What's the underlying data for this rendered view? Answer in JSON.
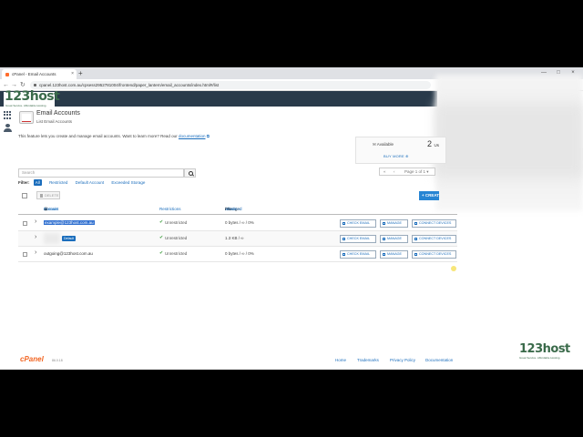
{
  "browser": {
    "tab_title": "cPanel - Email Accounts",
    "close_glyph": "×",
    "new_tab": "+",
    "url": "cpanel.123host.com.au/cpsess2952781004/frontend/paper_lantern/email_accounts/index.html#/list",
    "nav": {
      "back": "←",
      "forward": "→",
      "reload": "↻"
    },
    "window": {
      "minimize": "—",
      "maximize": "□",
      "close": "×"
    }
  },
  "brand": {
    "logo": "123host",
    "tagline": "Great Service. Affordable Hosting."
  },
  "page": {
    "title": "Email Accounts",
    "subtitle": "List Email Accounts",
    "intro": "This feature lets you create and manage email accounts. Want to learn more? Read our",
    "intro_link": "documentation",
    "link_icon": "⧉"
  },
  "stats": {
    "label": "Available",
    "count": "2",
    "unit": "Us",
    "buy_more": "BUY MORE ⊕"
  },
  "search": {
    "placeholder": "Search"
  },
  "filter": {
    "label": "Filter:",
    "items": [
      "All",
      "Restricted",
      "Default Account",
      "Exceeded Storage"
    ]
  },
  "pager": {
    "first": "«",
    "prev": "‹",
    "text": "Page 1 of 1 ▾"
  },
  "toolbar": {
    "delete": "DELETE",
    "create": "+ CREATE"
  },
  "table": {
    "headers": {
      "account": "Account",
      "at": "@",
      "domain": "Domain",
      "restrictions": "Restrictions",
      "storage_prefix": "Storage:",
      "storage_used": "Used",
      "storage_sep": "/",
      "storage_alloc": "Allocated",
      "storage_pct": "/ %"
    },
    "rows": [
      {
        "account": "example@123host.com.au",
        "restriction": "Unrestricted",
        "storage": "0 bytes / ∞ / 0%",
        "highlighted": true
      },
      {
        "account": "",
        "default_badge": "Default",
        "restriction": "Unrestricted",
        "storage": "1.3 KB / ∞"
      },
      {
        "account": "outgoing@123host.com.au",
        "restriction": "Unrestricted",
        "storage": "0 bytes / ∞ / 0%"
      }
    ],
    "actions": {
      "check": "CHECK EMAIL",
      "manage": "MANAGE",
      "connect": "CONNECT DEVICES"
    }
  },
  "footer": {
    "logo": "cPanel",
    "version": "86.0.18",
    "links": [
      "Home",
      "Trademarks",
      "Privacy Policy",
      "Documentation"
    ]
  },
  "colors": {
    "accent": "#1a6dbc",
    "header": "#293a4a",
    "cpanel": "#f26522",
    "brand": "#3a6a4a"
  }
}
